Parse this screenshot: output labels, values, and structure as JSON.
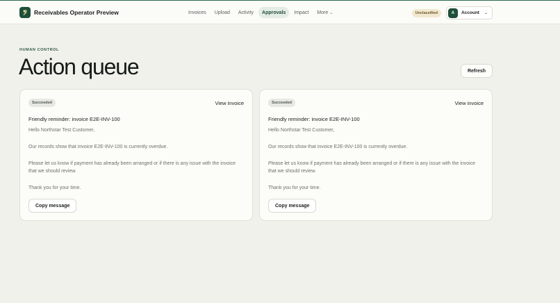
{
  "header": {
    "brand_name": "Receivables Operator Preview",
    "nav": [
      {
        "label": "Invoices"
      },
      {
        "label": "Upload"
      },
      {
        "label": "Activity"
      },
      {
        "label": "Approvals"
      },
      {
        "label": "Impact"
      },
      {
        "label": "More"
      }
    ],
    "active_nav": "Approvals",
    "classification_badge": "Unclassified",
    "account": {
      "avatar_letter": "A",
      "label": "Account"
    }
  },
  "page": {
    "eyebrow": "HUMAN CONTROL",
    "title": "Action queue",
    "refresh_label": "Refresh"
  },
  "cards": [
    {
      "status": "Succeeded",
      "view_link": "View invoice",
      "subject": "Friendly reminder: invoice E2E-INV-100",
      "body": [
        "Hello Northstar Test Customer,",
        "Our records show that invoice E2E-INV-100 is currently overdue.",
        "Please let us know if payment has already been arranged or if there is any issue with the invoice that we should review.",
        "Thank you for your time."
      ],
      "copy_label": "Copy message"
    },
    {
      "status": "Succeeded",
      "view_link": "View invoice",
      "subject": "Friendly reminder: invoice E2E-INV-100",
      "body": [
        "Hello Northstar Test Customer,",
        "Our records show that invoice E2E-INV-100 is currently overdue.",
        "Please let us know if payment has already been arranged or if there is any issue with the invoice that we should review.",
        "Thank you for your time."
      ],
      "copy_label": "Copy message"
    }
  ],
  "colors": {
    "brand": "#1f4f3a",
    "background": "#f1f1ec",
    "active_nav_bg": "#e4ede5",
    "unclassified_badge_bg": "#f2e8cf"
  },
  "icons": {
    "logo": "currency-logo-icon",
    "more": "chevron-down-icon",
    "account": "chevron-down-icon"
  }
}
